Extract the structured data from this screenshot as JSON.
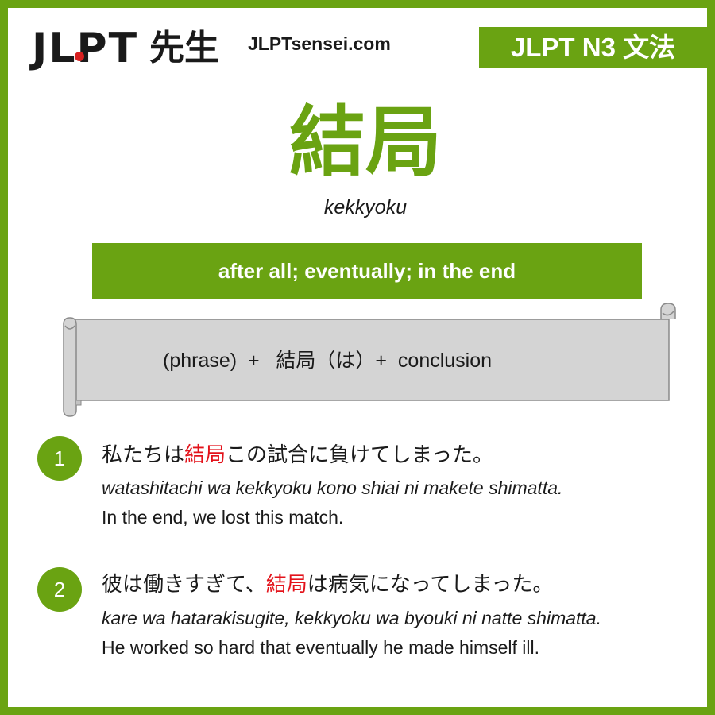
{
  "header": {
    "logo_text": "JLPT",
    "logo_kanji": "先生",
    "site": "JLPTsensei.com",
    "level_badge": "JLPT N3 文法"
  },
  "grammar": {
    "title": "結局",
    "reading": "kekkyoku",
    "meaning": "after all; eventually; in the end",
    "formula": "(phrase)  +   結局（は）+  conclusion"
  },
  "examples": [
    {
      "number": "1",
      "jp_before": "私たちは",
      "jp_highlight": "結局",
      "jp_after": "この試合に負けてしまった。",
      "romaji": "watashitachi wa kekkyoku kono shiai ni makete shimatta.",
      "english": "In the end, we lost this match."
    },
    {
      "number": "2",
      "jp_before": "彼は働きすぎて、",
      "jp_highlight": "結局",
      "jp_after": "は病気になってしまった。",
      "romaji": "kare wa hatarakisugite, kekkyoku wa byouki ni natte shimatta.",
      "english": "He worked so hard that eventually he made himself ill."
    }
  ],
  "colors": {
    "accent": "#6aa312",
    "highlight": "#e3131b",
    "logo_dot": "#d71f1f",
    "scroll_fill": "#d4d4d4",
    "scroll_stroke": "#8a8a8a"
  }
}
